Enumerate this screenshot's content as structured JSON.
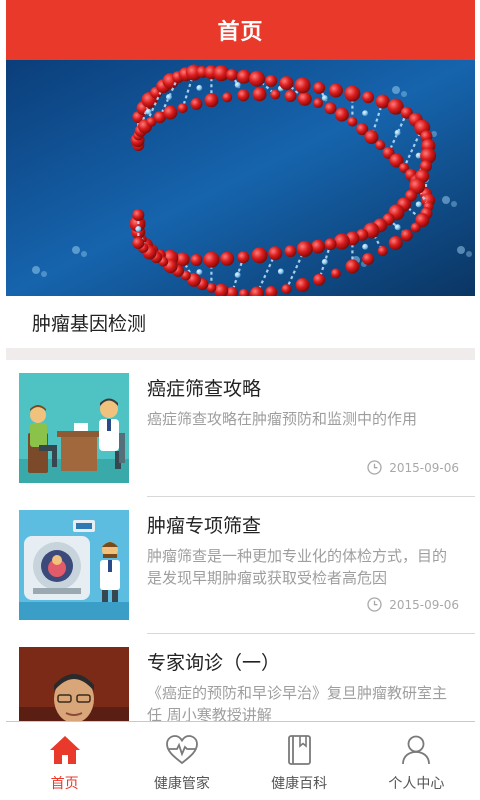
{
  "header": {
    "title": "首页"
  },
  "banner": {
    "caption": "肿瘤基因检测",
    "image_icon": "dna-molecule-image",
    "slide_count": 1,
    "active_slide": 1
  },
  "articles": [
    {
      "title": "癌症筛查攻略",
      "desc": "癌症筛查攻略在肿瘤预防和监测中的作用",
      "date": "2015-09-06",
      "thumb_icon": "doctor-consultation-illustration"
    },
    {
      "title": "肿瘤专项筛查",
      "desc": "肿瘤筛查是一种更加专业化的体检方式，目的是发现早期肿瘤或获取受检者高危因",
      "date": "2015-09-06",
      "thumb_icon": "medical-scanner-illustration"
    },
    {
      "title": "专家询诊（一）",
      "desc": "《癌症的预防和早诊早治》复旦肿瘤教研室主任 周小寒教授讲解",
      "date": "",
      "thumb_icon": "professor-portrait-photo"
    }
  ],
  "tabs": [
    {
      "label": "首页",
      "icon": "home-icon",
      "active": true
    },
    {
      "label": "健康管家",
      "icon": "heartbeat-icon",
      "active": false
    },
    {
      "label": "健康百科",
      "icon": "book-icon",
      "active": false
    },
    {
      "label": "个人中心",
      "icon": "person-icon",
      "active": false
    }
  ],
  "colors": {
    "accent": "#e8392b",
    "text_primary": "#222222",
    "text_secondary": "#9e9e9e",
    "gap": "#f0ecec"
  }
}
